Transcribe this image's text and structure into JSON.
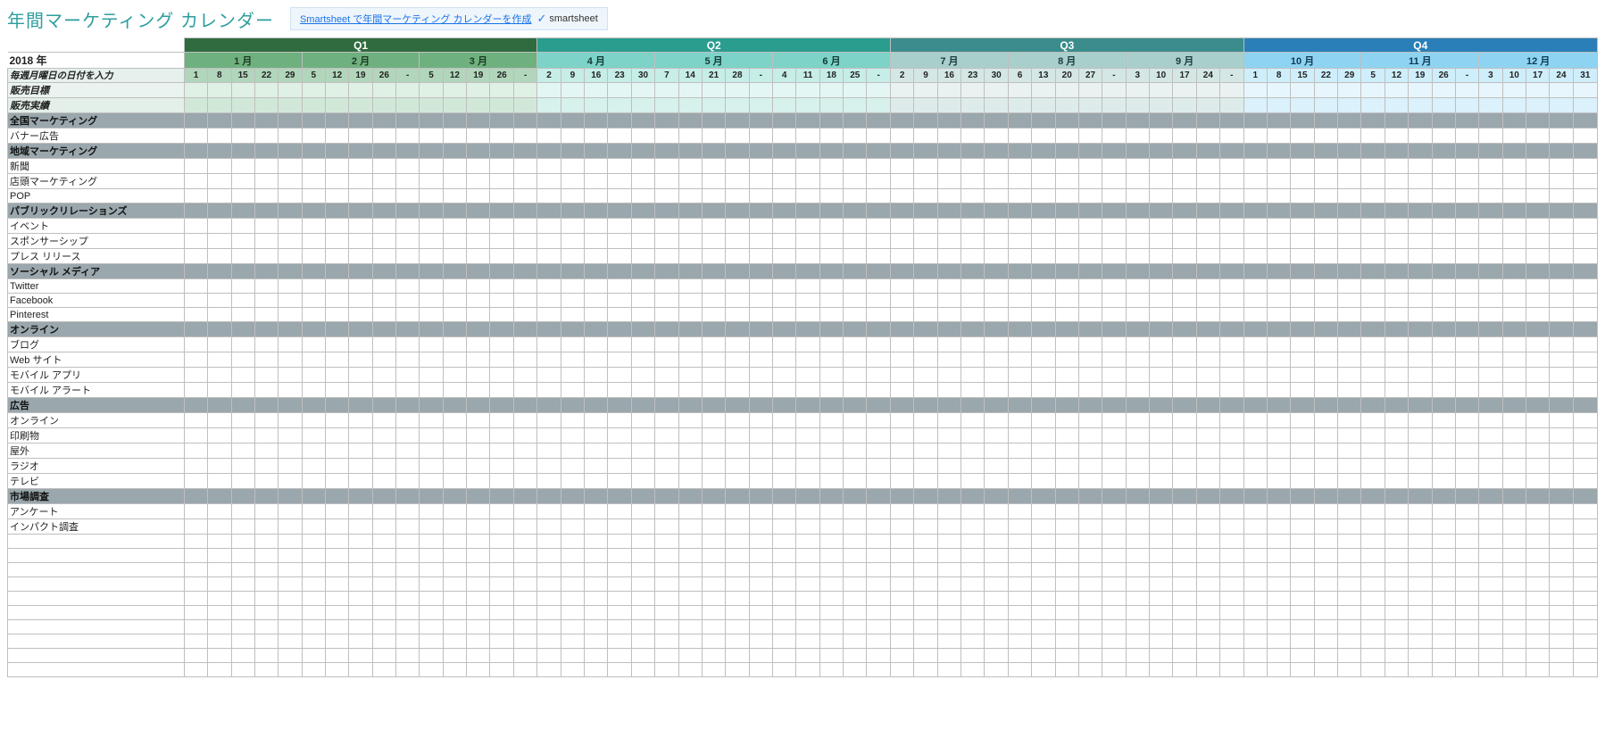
{
  "title": "年間マーケティング カレンダー",
  "link_text": "Smartsheet で年間マーケティング カレンダーを作成",
  "logo_text": "smartsheet",
  "year_label": "2018 年",
  "week_note": "毎週月曜日の日付を入力",
  "quarters": [
    "Q1",
    "Q2",
    "Q3",
    "Q4"
  ],
  "months": [
    "1 月",
    "2 月",
    "3 月",
    "4 月",
    "5 月",
    "6 月",
    "7 月",
    "8 月",
    "9 月",
    "10 月",
    "11 月",
    "12 月"
  ],
  "weeks": [
    [
      "1",
      "8",
      "15",
      "22",
      "29"
    ],
    [
      "5",
      "12",
      "19",
      "26",
      "-"
    ],
    [
      "5",
      "12",
      "19",
      "26",
      "-"
    ],
    [
      "2",
      "9",
      "16",
      "23",
      "30"
    ],
    [
      "7",
      "14",
      "21",
      "28",
      "-"
    ],
    [
      "4",
      "11",
      "18",
      "25",
      "-"
    ],
    [
      "2",
      "9",
      "16",
      "23",
      "30"
    ],
    [
      "6",
      "13",
      "20",
      "27",
      "-"
    ],
    [
      "3",
      "10",
      "17",
      "24",
      "-"
    ],
    [
      "1",
      "8",
      "15",
      "22",
      "29"
    ],
    [
      "5",
      "12",
      "19",
      "26",
      "-"
    ],
    [
      "3",
      "10",
      "17",
      "24",
      "31"
    ]
  ],
  "rows": [
    {
      "type": "metric1",
      "label": "販売目標"
    },
    {
      "type": "metric2",
      "label": "販売実績"
    },
    {
      "type": "section",
      "label": "全国マーケティング"
    },
    {
      "type": "entry",
      "label": "バナー広告"
    },
    {
      "type": "section",
      "label": "地域マーケティング"
    },
    {
      "type": "entry",
      "label": "新聞"
    },
    {
      "type": "entry",
      "label": "店頭マーケティング"
    },
    {
      "type": "entry",
      "label": "POP"
    },
    {
      "type": "section",
      "label": "パブリックリレーションズ"
    },
    {
      "type": "entry",
      "label": "イベント"
    },
    {
      "type": "entry",
      "label": "スポンサーシップ"
    },
    {
      "type": "entry",
      "label": "プレス リリース"
    },
    {
      "type": "section",
      "label": "ソーシャル メディア"
    },
    {
      "type": "entry",
      "label": "Twitter"
    },
    {
      "type": "entry",
      "label": "Facebook"
    },
    {
      "type": "entry",
      "label": "Pinterest"
    },
    {
      "type": "section",
      "label": "オンライン"
    },
    {
      "type": "entry",
      "label": "ブログ"
    },
    {
      "type": "entry",
      "label": "Web サイト"
    },
    {
      "type": "entry",
      "label": "モバイル アプリ"
    },
    {
      "type": "entry",
      "label": "モバイル アラート"
    },
    {
      "type": "section",
      "label": "広告"
    },
    {
      "type": "entry",
      "label": "オンライン"
    },
    {
      "type": "entry",
      "label": "印刷物"
    },
    {
      "type": "entry",
      "label": "屋外"
    },
    {
      "type": "entry",
      "label": "ラジオ"
    },
    {
      "type": "entry",
      "label": "テレビ"
    },
    {
      "type": "section",
      "label": "市場調査"
    },
    {
      "type": "entry",
      "label": "アンケート"
    },
    {
      "type": "entry",
      "label": "インパクト調査"
    }
  ],
  "trailing_empty_rows": 10
}
